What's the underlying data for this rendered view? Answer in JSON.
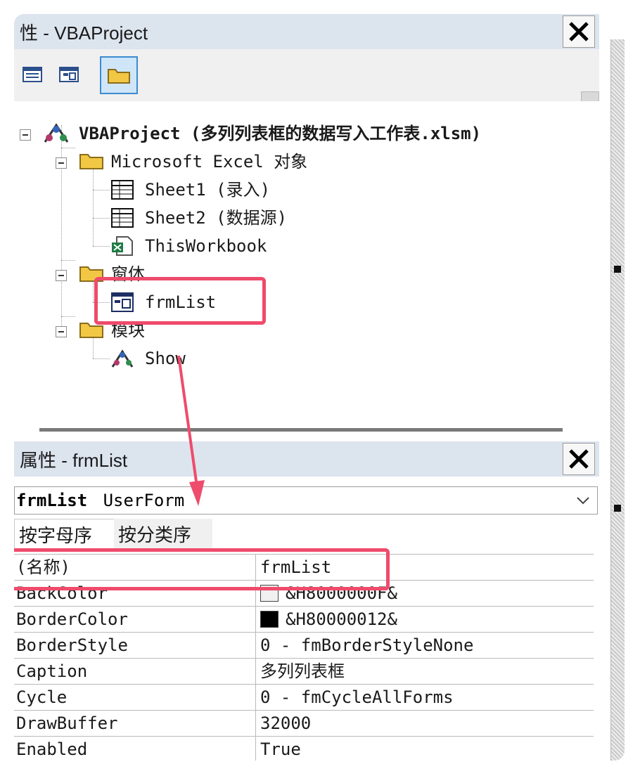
{
  "project_panel": {
    "title": "性 - VBAProject",
    "tree": {
      "root": "VBAProject (多列列表框的数据写入工作表.xlsm)",
      "folders": [
        {
          "label": "Microsoft Excel 对象",
          "items": [
            "Sheet1 (录入)",
            "Sheet2 (数据源)",
            "ThisWorkbook"
          ]
        },
        {
          "label": "窗体",
          "items": [
            "frmList"
          ]
        },
        {
          "label": "模块",
          "items": [
            "Show"
          ]
        }
      ]
    }
  },
  "properties_panel": {
    "title": "属性 - frmList",
    "object_name": "frmList",
    "object_type": "UserForm",
    "tabs": [
      "按字母序",
      "按分类序"
    ],
    "rows": [
      {
        "key": "(名称)",
        "value": "frmList"
      },
      {
        "key": "BackColor",
        "value": "&H8000000F&",
        "swatch": "#f0f0f0"
      },
      {
        "key": "BorderColor",
        "value": "&H80000012&",
        "swatch": "#000000"
      },
      {
        "key": "BorderStyle",
        "value": "0 - fmBorderStyleNone"
      },
      {
        "key": "Caption",
        "value": "多列列表框"
      },
      {
        "key": "Cycle",
        "value": "0 - fmCycleAllForms"
      },
      {
        "key": "DrawBuffer",
        "value": "32000"
      },
      {
        "key": "Enabled",
        "value": "True"
      }
    ]
  },
  "colors": {
    "highlight": "#ef4b6c",
    "titlebar": "#dce4ee",
    "accent": "#3c8bd1"
  },
  "icons": [
    "close-icon",
    "view-code-icon",
    "view-object-icon",
    "toggle-folders-icon",
    "project-icon",
    "folder-icon",
    "worksheet-icon",
    "workbook-icon",
    "userform-icon",
    "module-icon",
    "chevron-down-icon"
  ]
}
